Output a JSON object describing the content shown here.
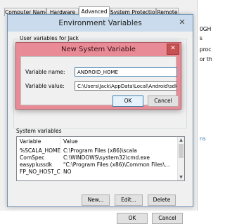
{
  "system_properties": {
    "tabs": [
      "Computer Name",
      "Hardware",
      "Advanced",
      "System Protection",
      "Remote"
    ],
    "active_tab": "Advanced"
  },
  "background_peek": {
    "lines": [
      "0GH",
      "s",
      "proc",
      "or th",
      "ns"
    ]
  },
  "environment_variables": {
    "title": "Environment Variables",
    "user_group_label": "User variables for Jack",
    "system_label": "System variables",
    "columns": [
      "Variable",
      "Value"
    ],
    "rows": [
      {
        "variable": "%SCALA_HOME%",
        "value": "C:\\Program Files (x86)\\scala"
      },
      {
        "variable": "ComSpec",
        "value": "C:\\WINDOWS\\system32\\cmd.exe"
      },
      {
        "variable": "easyplussdk",
        "value": "\"C:\\Program Files (x86)\\Common Files\\..."
      },
      {
        "variable": "FP_NO_HOST_C...",
        "value": "NO"
      }
    ],
    "buttons": {
      "new": "New...",
      "edit": "Edit...",
      "delete": "Delete",
      "ok": "OK",
      "cancel": "Cancel"
    }
  },
  "new_system_variable": {
    "title": "New System Variable",
    "name_label": "Variable name:",
    "name_value": "ANDROID_HOME",
    "value_label": "Variable value:",
    "value_value": "C:\\Users\\Jack\\AppData\\Local\\Android\\sdk",
    "ok": "OK",
    "cancel": "Cancel"
  },
  "colors": {
    "accent": "#3c7fb1",
    "dialog_frame": "#e98b96",
    "env_titlebar": "#c9dbec"
  }
}
